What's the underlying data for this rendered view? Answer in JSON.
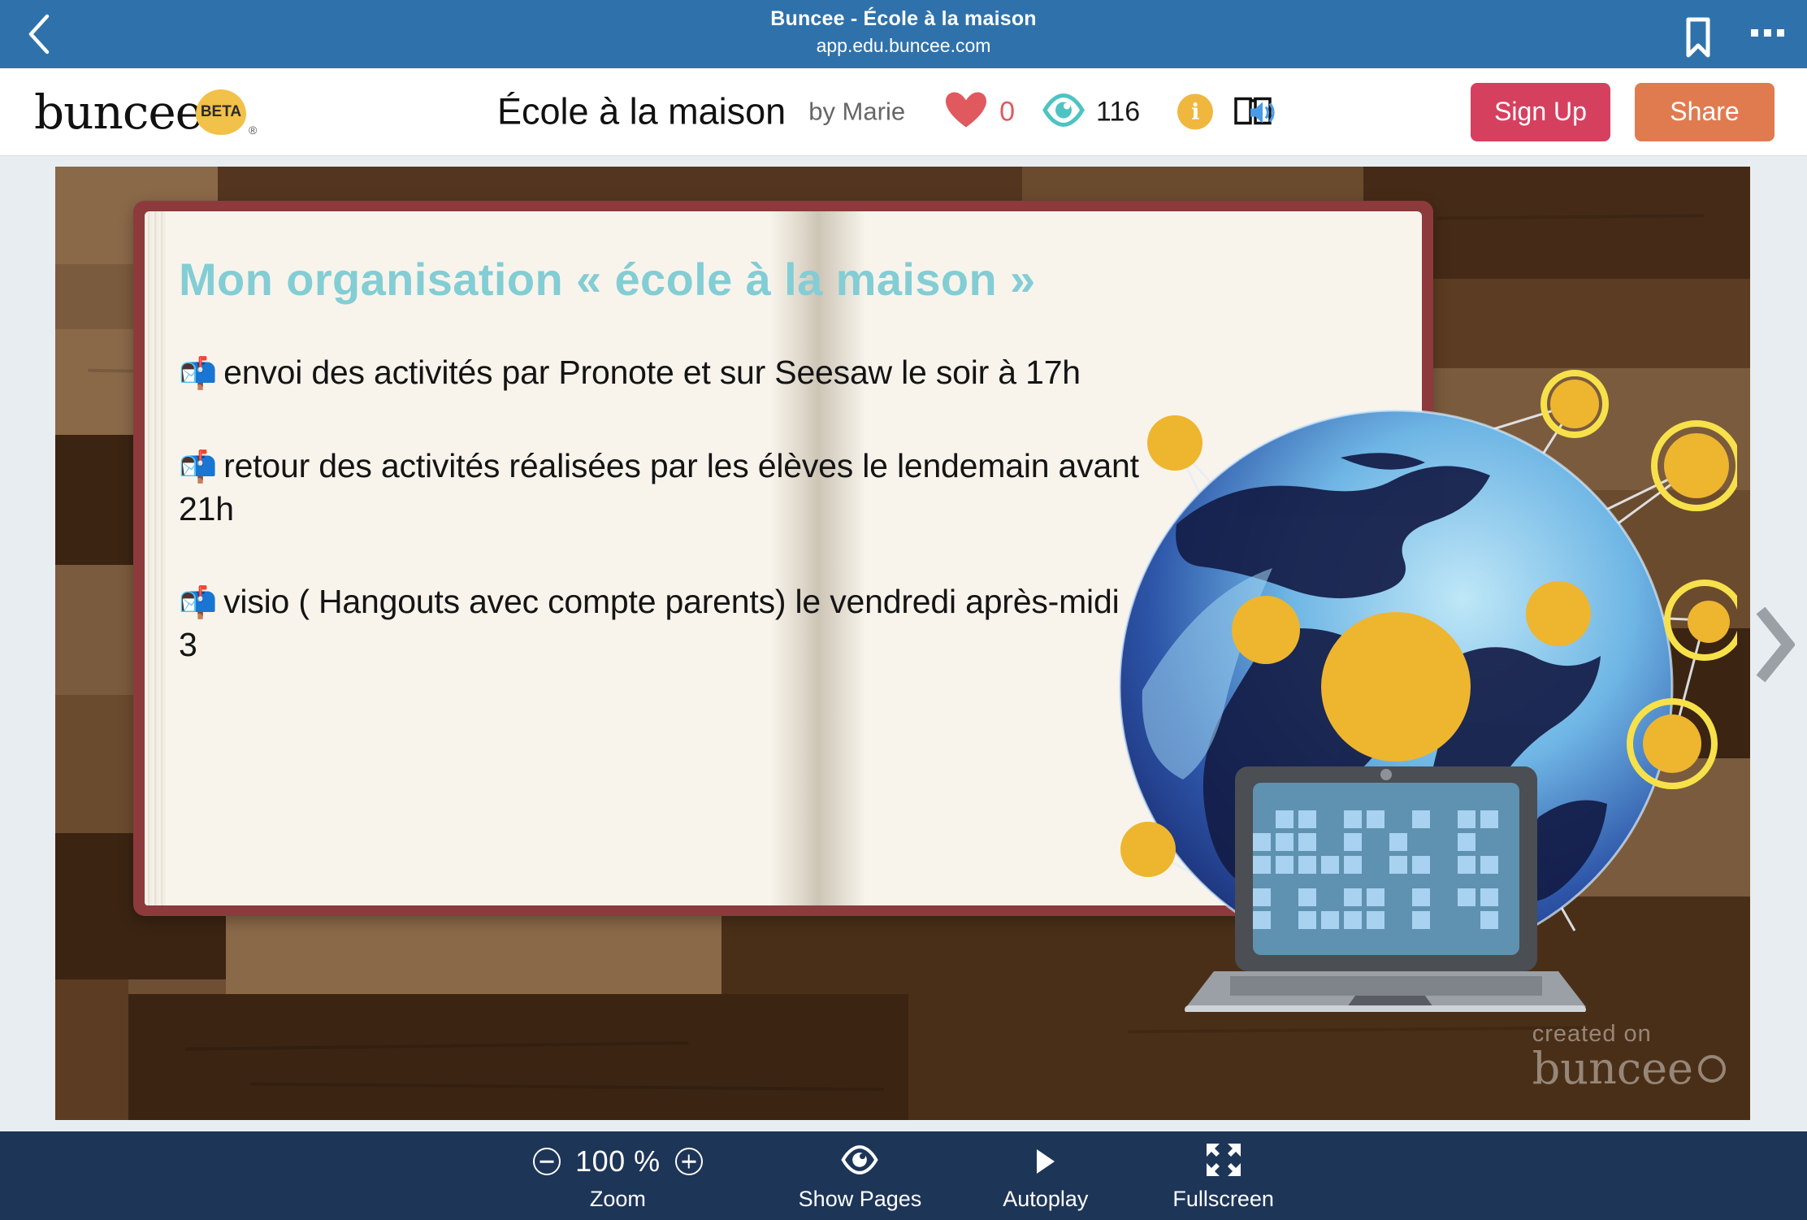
{
  "browser": {
    "title": "Buncee - École à la maison",
    "url": "app.edu.buncee.com",
    "back_icon": "back-chevron-icon",
    "bookmark_icon": "bookmark-icon",
    "menu_icon": "more-options-icon"
  },
  "header": {
    "logo_text": "buncee",
    "logo_badge": "BETA",
    "registered_mark": "®",
    "doc_title": "École à la maison",
    "doc_author": "by Marie",
    "likes": "0",
    "views": "116",
    "info_label": "i",
    "read_aloud_icon": "book-speaker-icon",
    "heart_icon": "heart-icon",
    "eye_icon": "eye-icon",
    "signup_label": "Sign Up",
    "share_label": "Share",
    "colors": {
      "signup": "#d6405f",
      "share": "#e07b50",
      "heart": "#e0595e",
      "eye": "#4ec3c3",
      "info": "#f0b73f",
      "browser_bar": "#2f72ab",
      "toolbar": "#1d3557"
    }
  },
  "slide": {
    "title": "Mon organisation « école à la maison »",
    "title_color": "#83cdd4",
    "bullets": [
      {
        "emoji": "📬",
        "text": "envoi des activités par Pronote et sur Seesaw le soir à 17h"
      },
      {
        "emoji": "📬",
        "text": "retour des activités réalisées par les élèves le lendemain avant 21h"
      },
      {
        "emoji": "📬",
        "text": "visio ( Hangouts avec compte parents) le vendredi après-midi 3"
      }
    ],
    "watermark_line1": "created on",
    "watermark_line2": "buncee",
    "next_icon": "next-page-chevron-icon"
  },
  "toolbar": {
    "zoom_minus": "zoom-out-icon",
    "zoom_value": "100 %",
    "zoom_plus": "zoom-in-icon",
    "zoom_label": "Zoom",
    "pages_icon": "eye-icon",
    "pages_label": "Show Pages",
    "autoplay_icon": "play-icon",
    "autoplay_label": "Autoplay",
    "fullscreen_icon": "fullscreen-icon",
    "fullscreen_label": "Fullscreen"
  }
}
